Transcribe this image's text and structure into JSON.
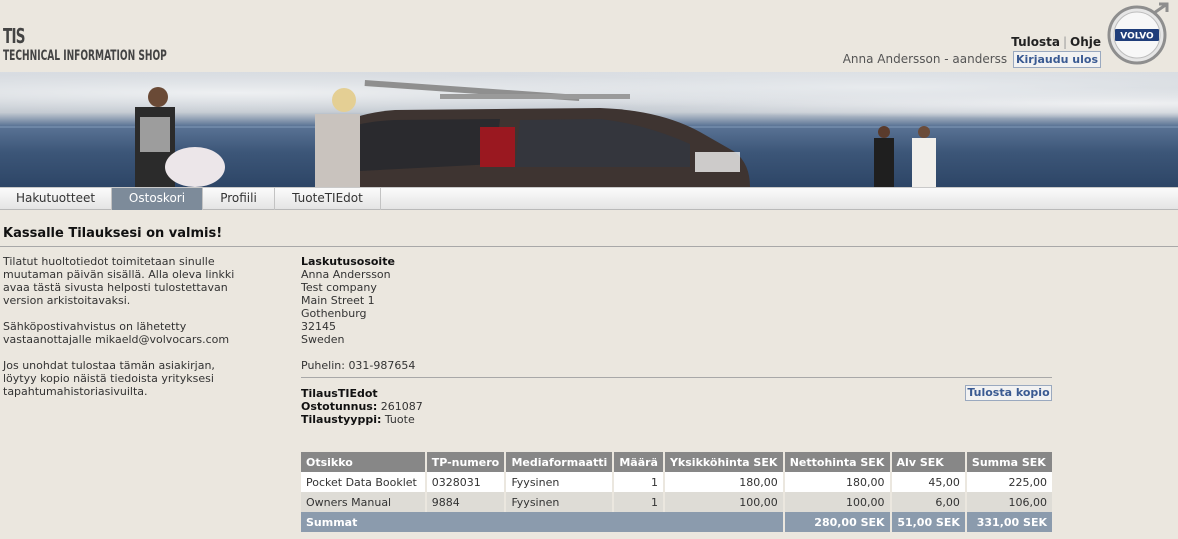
{
  "brand": {
    "short": "TIS",
    "long": "TECHNICAL INFORMATION SHOP"
  },
  "header": {
    "print_link": "Tulosta",
    "help_link": "Ohje",
    "user_text": "Anna Andersson - aanderss",
    "logout": "Kirjaudu ulos",
    "logo_text": "VOLVO"
  },
  "nav": {
    "tabs": [
      {
        "label": "Hakutuotteet",
        "active": false
      },
      {
        "label": "Ostoskori",
        "active": true
      },
      {
        "label": "Profiili",
        "active": false
      },
      {
        "label": "TuoteTIEdot",
        "active": false
      }
    ]
  },
  "page": {
    "heading": "Kassalle Tilauksesi on valmis!",
    "info_paragraphs": [
      "Tilatut huoltotiedot toimitetaan sinulle muutaman päivän sisällä. Alla oleva linkki avaa tästä sivusta helposti tulostettavan version arkistoitavaksi.",
      "Sähköpostivahvistus on lähetetty vastaanottajalle mikaeld@volvocars.com",
      "Jos unohdat tulostaa tämän asiakirjan, löytyy kopio näistä tiedoista yrityksesi tapahtumahistoriasivuilta."
    ]
  },
  "billing": {
    "title": "Laskutusosoite",
    "name": "Anna Andersson",
    "company": "Test company",
    "street": "Main Street 1",
    "city": "Gothenburg",
    "zip": "32145",
    "country": "Sweden",
    "phone": "Puhelin: 031-987654"
  },
  "order": {
    "title": "TilausTIEdot",
    "number_label": "Ostotunnus:",
    "number": "261087",
    "type_label": "Tilaustyyppi:",
    "type": "Tuote",
    "print_copy": "Tulosta kopio"
  },
  "table": {
    "headers": [
      "Otsikko",
      "TP-numero",
      "Mediaformaatti",
      "Määrä",
      "Yksikköhinta SEK",
      "Nettohinta SEK",
      "Alv SEK",
      "Summa SEK"
    ],
    "rows": [
      [
        "Pocket Data Booklet",
        "0328031",
        "Fyysinen",
        "1",
        "180,00",
        "180,00",
        "45,00",
        "225,00"
      ],
      [
        "Owners Manual",
        "9884",
        "Fyysinen",
        "1",
        "100,00",
        "100,00",
        "6,00",
        "106,00"
      ]
    ],
    "totals": {
      "label": "Summat",
      "net": "280,00 SEK",
      "vat": "51,00 SEK",
      "sum": "331,00 SEK"
    }
  }
}
